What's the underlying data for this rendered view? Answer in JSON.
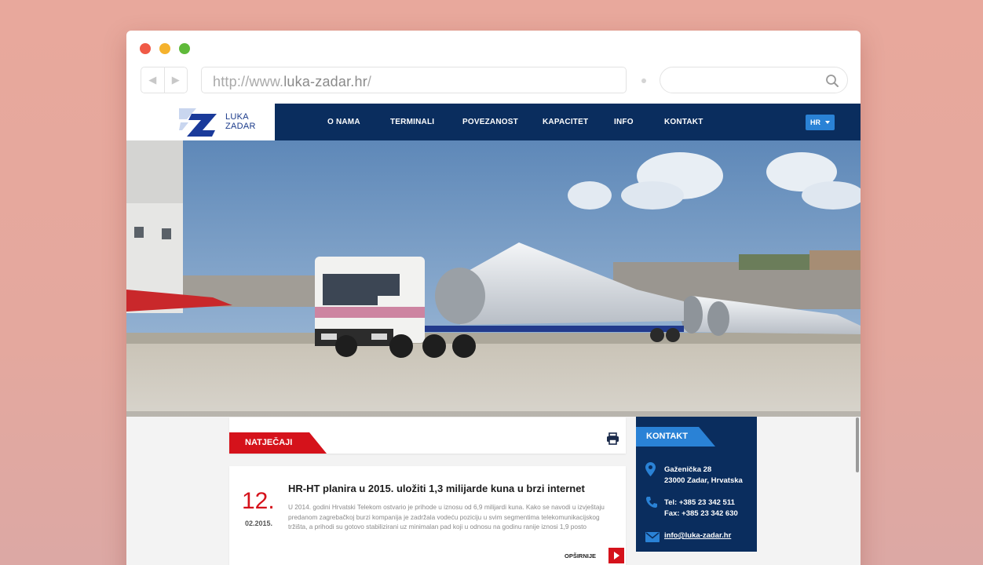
{
  "browser": {
    "url_prefix": "http://www.",
    "url_host": "luka-zadar.hr",
    "url_suffix": "/",
    "search_value": ""
  },
  "logo": {
    "line1": "LUKA",
    "line2": "ZADAR"
  },
  "nav": {
    "items": [
      "O NAMA",
      "TERMINALI",
      "POVEZANOST",
      "KAPACITET",
      "INFO",
      "KONTAKT"
    ],
    "language": "HR"
  },
  "section": {
    "label": "NATJEČAJI"
  },
  "news": {
    "day": "12.",
    "date": "02.2015.",
    "title": "HR-HT planira u 2015. uložiti 1,3 milijarde kuna u brzi internet",
    "body": "U 2014. godini Hrvatski Telekom ostvario je prihode u iznosu od 6,9 milijardi kuna. Kako se navodi u izvještaju predanom zagrebačkoj burzi kompanija je zadržala vodeću poziciju u svim segmentima telekomunikacijskog tržišta, a prihodi su gotovo stabilizirani uz minimalan pad koji u odnosu na godinu ranije iznosi 1,9 posto",
    "more_label": "OPŠIRNIJE"
  },
  "contact": {
    "label": "KONTAKT",
    "address_line1": "Gaženička 28",
    "address_line2": "23000 Zadar, Hrvatska",
    "tel": "Tel: +385 23 342 511",
    "fax": "Fax: +385 23 342 630",
    "email": "info@luka-zadar.hr"
  },
  "colors": {
    "navy": "#0a2d5e",
    "accent_red": "#d5121b",
    "accent_blue": "#2a82d6"
  }
}
